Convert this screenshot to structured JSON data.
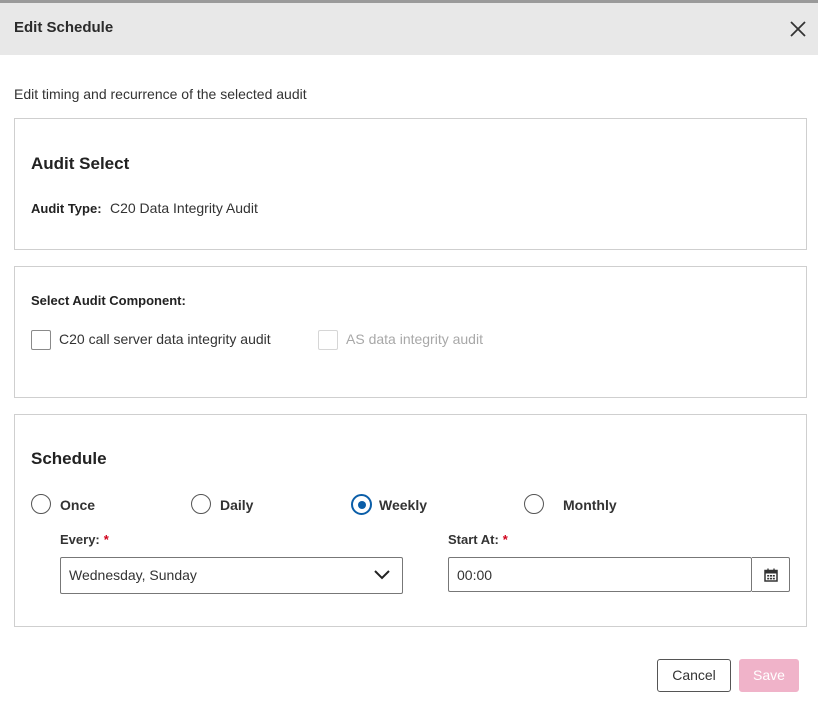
{
  "dialog": {
    "title": "Edit Schedule",
    "subtitle": "Edit timing and recurrence of the selected audit"
  },
  "audit_select": {
    "heading": "Audit Select",
    "type_label": "Audit Type:",
    "type_value": "C20 Data Integrity Audit"
  },
  "component": {
    "label": "Select Audit Component:",
    "options": [
      {
        "label": "C20 call server data integrity audit",
        "checked": false,
        "disabled": false
      },
      {
        "label": "AS data integrity audit",
        "checked": false,
        "disabled": true
      }
    ]
  },
  "schedule": {
    "heading": "Schedule",
    "frequencies": [
      {
        "label": "Once",
        "selected": false
      },
      {
        "label": "Daily",
        "selected": false
      },
      {
        "label": "Weekly",
        "selected": true
      },
      {
        "label": "Monthly",
        "selected": false
      }
    ],
    "every_label": "Every:",
    "every_value": "Wednesday, Sunday",
    "start_label": "Start At:",
    "start_value": "00:00",
    "required_mark": "*"
  },
  "footer": {
    "cancel_label": "Cancel",
    "save_label": "Save"
  },
  "colors": {
    "accent": "#0b5ea8",
    "required": "#d0021b",
    "save_disabled": "#f0b3c9",
    "header_bg": "#e8e8e8"
  },
  "icons": {
    "close": "close-icon",
    "chevron": "chevron-down-icon",
    "calendar": "calendar-icon"
  }
}
